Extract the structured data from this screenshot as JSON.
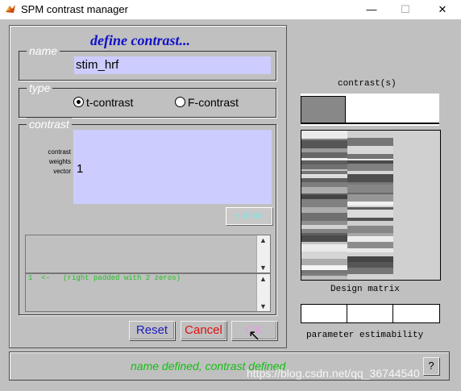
{
  "window": {
    "title": "SPM contrast manager"
  },
  "panel": {
    "heading": "define contrast..."
  },
  "name_group": {
    "legend": "name",
    "value": "stim_hrf"
  },
  "type_group": {
    "legend": "type",
    "options": [
      "t-contrast",
      "F-contrast"
    ],
    "selected": "t-contrast"
  },
  "contrast_group": {
    "legend": "contrast",
    "weights_label": [
      "contrast",
      "weights",
      "vector"
    ],
    "weights_value": "1",
    "submit_label": "submit",
    "message": "1  <-   (right padded with 2 zeros)"
  },
  "buttons": {
    "reset": "Reset",
    "cancel": "Cancel",
    "ok": "OK"
  },
  "status": {
    "text": "name defined, contrast defined",
    "help": "?"
  },
  "right": {
    "contrasts_title": "contrast(s)",
    "contrast_weights": [
      1,
      0,
      0
    ],
    "design_matrix_label": "Design matrix",
    "estimability_label": "parameter estimability"
  },
  "watermark": "https://blog.csdn.net/qq_36744540",
  "colors": {
    "heading": "#1010c8",
    "input_bg": "#ccccff",
    "status_text": "#10c010"
  }
}
